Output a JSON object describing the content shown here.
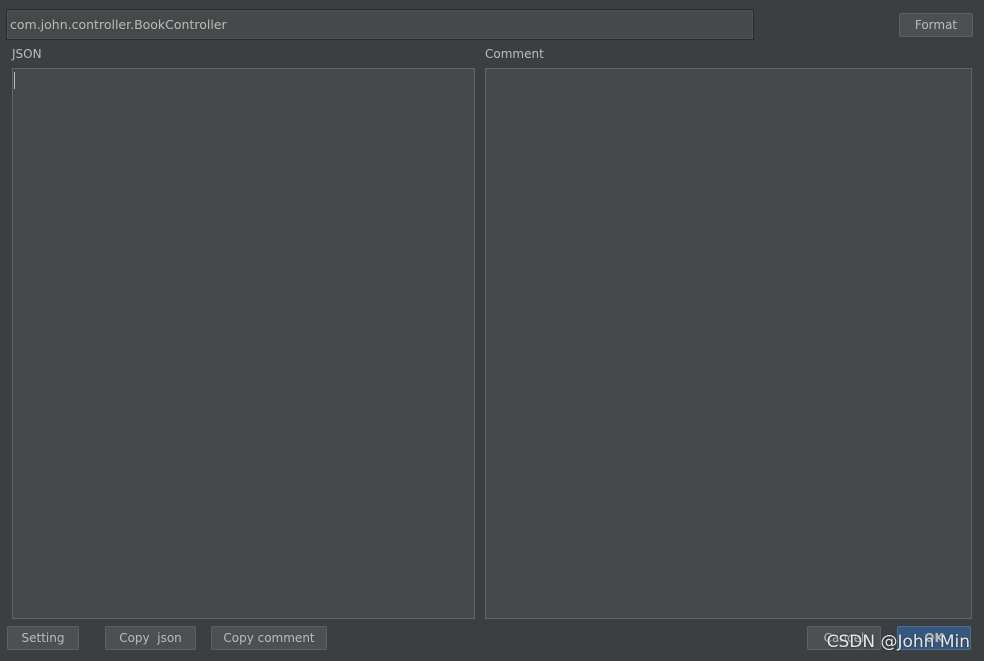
{
  "class_field": {
    "value": "com.john.controller.BookController"
  },
  "toolbar": {
    "format_label": "Format"
  },
  "panels": {
    "json_label": "JSON",
    "json_value": "",
    "comment_label": "Comment",
    "comment_value": ""
  },
  "footer": {
    "setting_label": "Setting",
    "copy_json_label": "Copy  json",
    "copy_comment_label": "Copy comment",
    "cancel_label": "Cancel",
    "ok_label": "OK"
  },
  "watermark": {
    "text": "CSDN @John Min"
  },
  "colors": {
    "background": "#3c3f41",
    "field_background": "#45494a",
    "text": "#bbbbbb",
    "ok_button": "#365880"
  }
}
